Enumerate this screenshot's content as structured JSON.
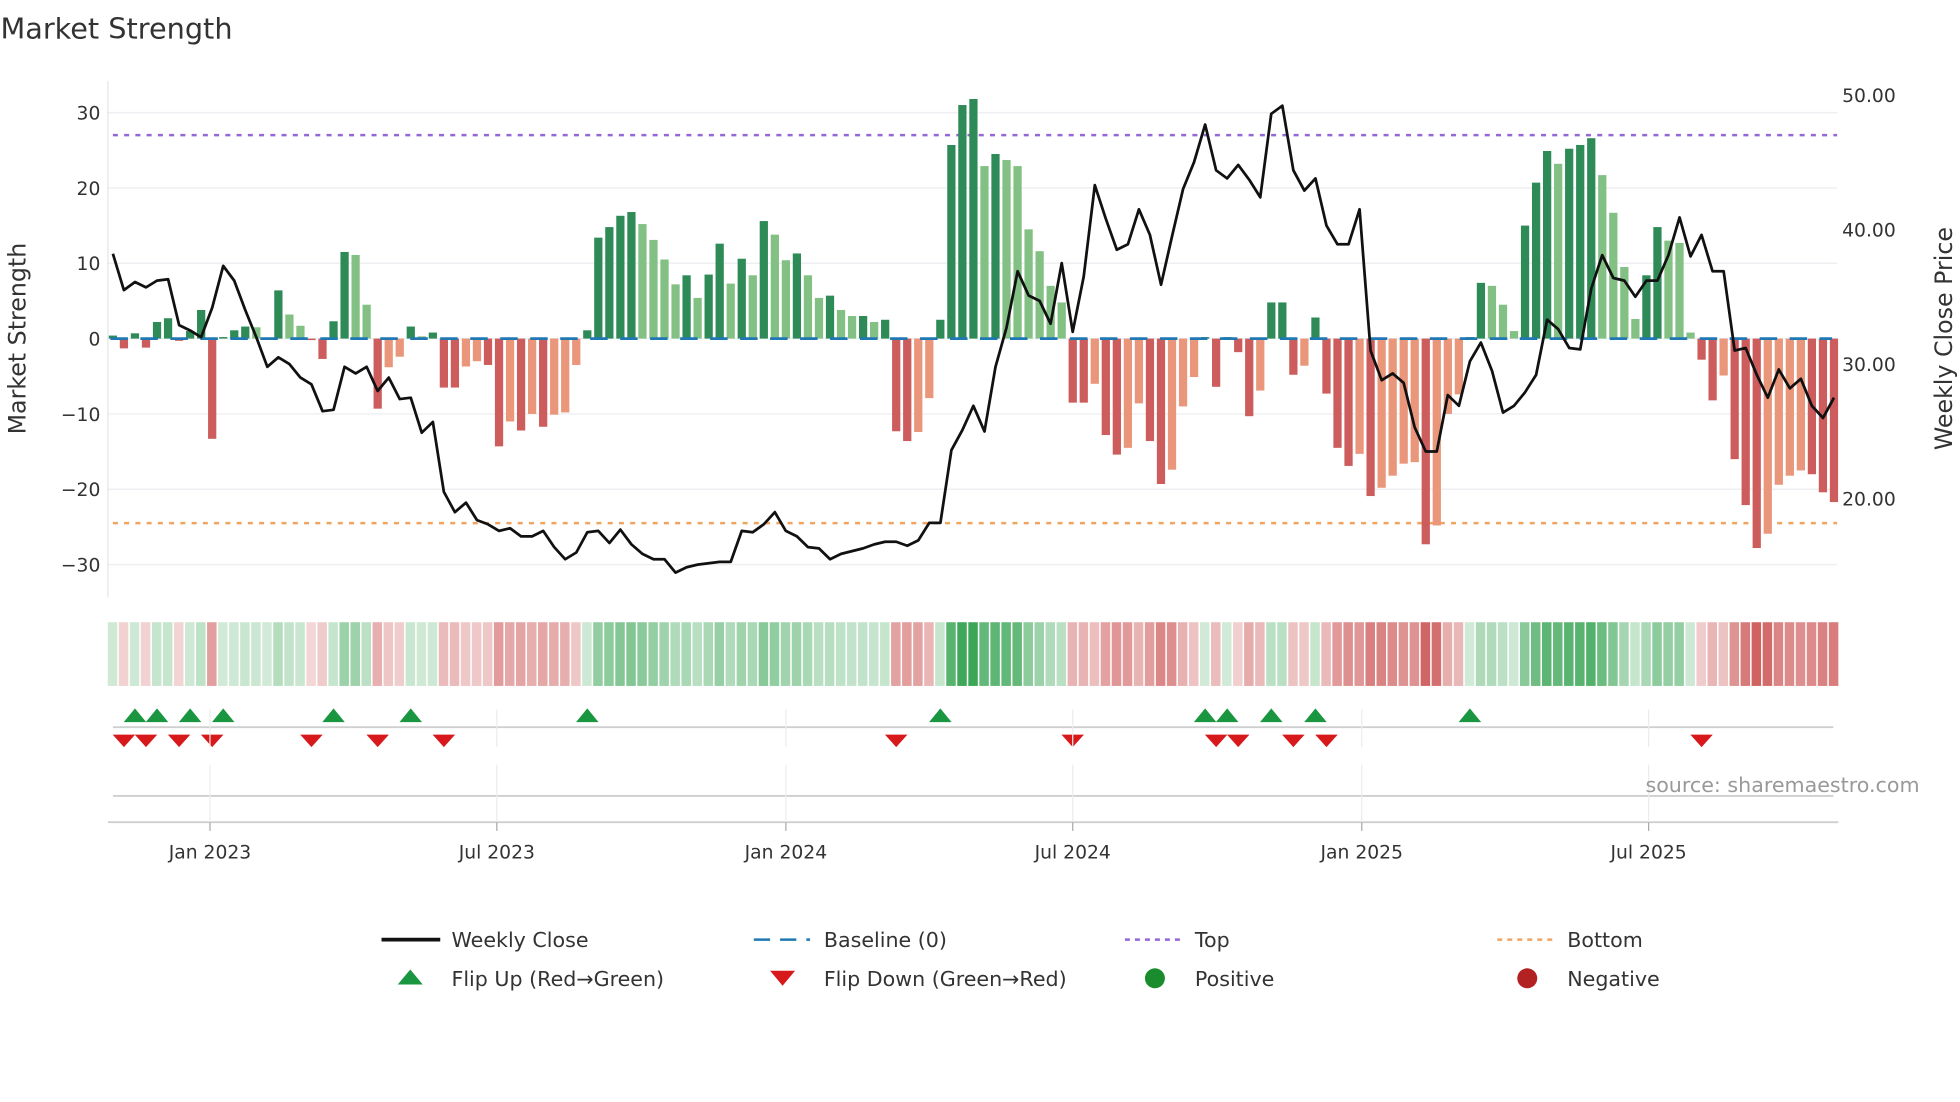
{
  "chart_data": {
    "type": "bar",
    "title": "Market Strength",
    "ylabel": "Market Strength",
    "y2label": "Weekly Close Price",
    "ylim": [
      -33,
      34
    ],
    "y2lim": [
      12.2,
      51.3
    ],
    "y_ticks": [
      "30",
      "20",
      "10",
      "0",
      "−10",
      "−20",
      "−30"
    ],
    "y_tick_values": [
      30,
      20,
      10,
      0,
      -10,
      -20,
      -30
    ],
    "y2_ticks": [
      "50.00",
      "40.00",
      "30.00",
      "20.00"
    ],
    "y2_tick_values": [
      50,
      40,
      30,
      20
    ],
    "x_ticks": [
      {
        "label": "Jan 2023",
        "week": 8.8
      },
      {
        "label": "Jul 2023",
        "week": 34.8
      },
      {
        "label": "Jan 2024",
        "week": 61.0
      },
      {
        "label": "Jul 2024",
        "week": 87.0
      },
      {
        "label": "Jan 2025",
        "week": 113.2
      },
      {
        "label": "Jul 2025",
        "week": 139.2
      }
    ],
    "top_level": 27,
    "bottom_level": -24.5,
    "baseline": 0,
    "grid": true,
    "legend_placement": "bottom-center",
    "series": [
      {
        "name": "Market Strength",
        "type": "bar",
        "values": [
          0.4,
          -1.3,
          0.7,
          -1.2,
          2.2,
          2.7,
          -0.3,
          1.0,
          3.8,
          -13.3,
          0.2,
          1.1,
          1.6,
          1.5,
          0.1,
          6.4,
          3.2,
          1.7,
          -0.2,
          -2.7,
          2.3,
          11.5,
          11.1,
          4.5,
          -9.3,
          -3.8,
          -2.4,
          1.6,
          0.3,
          0.8,
          -6.5,
          -6.5,
          -3.7,
          -3.0,
          -3.5,
          -14.3,
          -11.0,
          -12.2,
          -10.0,
          -11.7,
          -10.1,
          -9.8,
          -3.5,
          1.1,
          13.4,
          14.8,
          16.3,
          16.8,
          15.2,
          13.1,
          10.5,
          7.2,
          8.4,
          5.4,
          8.5,
          12.6,
          7.3,
          10.6,
          8.4,
          15.6,
          13.8,
          10.4,
          11.3,
          8.4,
          5.4,
          5.7,
          3.8,
          3.0,
          3.0,
          2.2,
          2.5,
          -12.3,
          -13.6,
          -12.4,
          -7.9,
          2.5,
          25.7,
          31.0,
          31.8,
          22.9,
          24.5,
          23.7,
          22.9,
          14.5,
          11.6,
          7.0,
          4.8,
          -8.5,
          -8.5,
          -6.0,
          -12.8,
          -15.4,
          -14.5,
          -8.6,
          -13.6,
          -19.3,
          -17.4,
          -9.0,
          -5.1,
          0.2,
          -6.4,
          0.2,
          -1.8,
          -10.3,
          -6.9,
          4.8,
          4.8,
          -4.8,
          -3.6,
          2.8,
          -7.3,
          -14.5,
          -16.9,
          -15.3,
          -20.9,
          -19.8,
          -18.2,
          -16.6,
          -16.4,
          -27.3,
          -24.8,
          -10.0,
          -7.4,
          0.2,
          7.4,
          7.0,
          4.5,
          1.0,
          15.0,
          20.7,
          24.9,
          23.2,
          25.2,
          25.7,
          26.6,
          21.7,
          16.7,
          9.5,
          2.6,
          8.4,
          14.8,
          13.0,
          12.7,
          0.8,
          -2.8,
          -8.2,
          -4.9,
          -16.0,
          -22.1,
          -27.8,
          -25.9,
          -19.4,
          -18.2,
          -17.5,
          -18.0,
          -20.4,
          -21.7
        ]
      },
      {
        "name": "Weekly Close",
        "type": "line",
        "axis": "right",
        "values": [
          38.2,
          35.5,
          36.1,
          35.7,
          36.2,
          36.3,
          32.9,
          32.5,
          32.0,
          34.2,
          37.3,
          36.2,
          34.0,
          32.0,
          29.8,
          30.5,
          30.0,
          29.0,
          28.5,
          26.5,
          26.6,
          29.8,
          29.3,
          29.8,
          28.0,
          29.0,
          27.4,
          27.5,
          24.9,
          25.7,
          20.5,
          19.0,
          19.7,
          18.4,
          18.1,
          17.6,
          17.8,
          17.2,
          17.2,
          17.6,
          16.4,
          15.5,
          16.0,
          17.5,
          17.6,
          16.7,
          17.7,
          16.6,
          15.9,
          15.5,
          15.5,
          14.5,
          14.9,
          15.1,
          15.2,
          15.3,
          15.3,
          17.6,
          17.5,
          18.1,
          19.0,
          17.6,
          17.2,
          16.4,
          16.3,
          15.5,
          15.9,
          16.1,
          16.3,
          16.6,
          16.8,
          16.8,
          16.5,
          16.9,
          18.2,
          18.2,
          23.6,
          25.1,
          26.9,
          25.0,
          29.8,
          32.7,
          36.9,
          35.1,
          34.7,
          33.0,
          37.5,
          32.4,
          36.5,
          43.3,
          40.8,
          38.5,
          38.9,
          41.5,
          39.6,
          35.9,
          39.5,
          43.0,
          45.0,
          47.8,
          44.4,
          43.8,
          44.8,
          43.7,
          42.4,
          48.6,
          49.2,
          44.4,
          42.9,
          43.8,
          40.3,
          38.9,
          38.9,
          41.5,
          31.0,
          28.8,
          29.3,
          28.6,
          25.3,
          23.5,
          23.5,
          27.7,
          26.9,
          30.2,
          31.6,
          29.5,
          26.4,
          26.9,
          27.9,
          29.2,
          33.3,
          32.6,
          31.2,
          31.1,
          35.6,
          38.1,
          36.4,
          36.2,
          35.0,
          36.2,
          36.2,
          38.1,
          40.9,
          38.0,
          39.6,
          36.9,
          36.9,
          31.0,
          31.2,
          29.2,
          27.5,
          29.6,
          28.2,
          28.9,
          26.9,
          26.0,
          27.5
        ]
      }
    ],
    "flip_up_weeks": [
      2,
      4,
      7,
      10,
      20,
      27,
      43,
      75,
      99,
      101,
      105,
      109,
      123
    ],
    "flip_down_weeks": [
      1,
      3,
      6,
      9,
      18,
      24,
      30,
      71,
      87,
      100,
      102,
      107,
      110,
      144
    ],
    "legend": [
      {
        "label": "Weekly Close",
        "symbol": "line",
        "color": "#111111"
      },
      {
        "label": "Baseline (0)",
        "symbol": "dash",
        "color": "#1f77b4"
      },
      {
        "label": "Top",
        "symbol": "dot",
        "color": "#9467d8"
      },
      {
        "label": "Bottom",
        "symbol": "dot",
        "color": "#f0a460"
      },
      {
        "label": "Flip Up (Red→Green)",
        "symbol": "triangle-up",
        "color": "#1a9641"
      },
      {
        "label": "Flip Down (Green→Red)",
        "symbol": "triangle-down",
        "color": "#d7191c"
      },
      {
        "label": "Positive",
        "symbol": "circle",
        "color": "#1a8c2e"
      },
      {
        "label": "Negative",
        "symbol": "circle",
        "color": "#b22222"
      }
    ],
    "source": "source: sharemaestro.com"
  },
  "colors": {
    "strong_up": "#2e8b57",
    "weak_up": "#82c084",
    "strong_down": "#cd5c5c",
    "weak_down": "#e9967a",
    "line": "#111111",
    "baseline": "#1f77b4",
    "top": "#9467d8",
    "bottom": "#f0a460"
  }
}
